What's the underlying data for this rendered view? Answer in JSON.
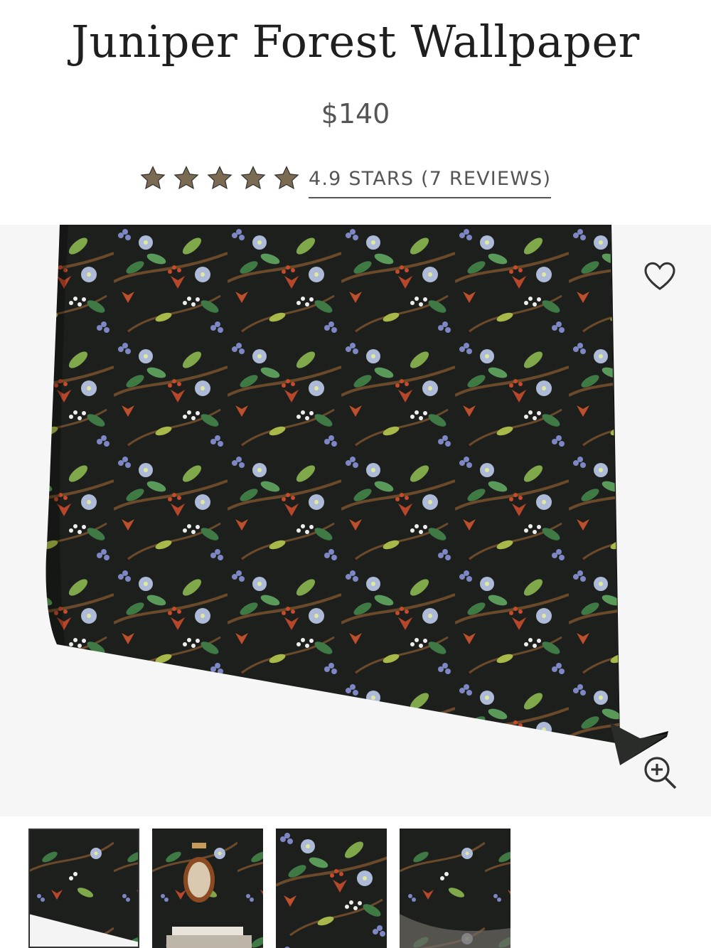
{
  "product": {
    "title": "Juniper Forest Wallpaper",
    "price": "$140",
    "rating_text": "4.9 STARS (7 REVIEWS)",
    "rating": 4.9,
    "star_count": 5
  },
  "icons": {
    "star": "star-icon",
    "favorite": "heart-icon",
    "zoom": "zoom-in-icon"
  },
  "colors": {
    "star": "#7a6b52",
    "background": "#ffffff",
    "hero_background": "#f6f6f6",
    "wallpaper_base": "#1d1f1d"
  },
  "gallery": {
    "thumbnails": [
      "thumbnail-1",
      "thumbnail-2",
      "thumbnail-3",
      "thumbnail-4"
    ],
    "selected_index": 0
  }
}
